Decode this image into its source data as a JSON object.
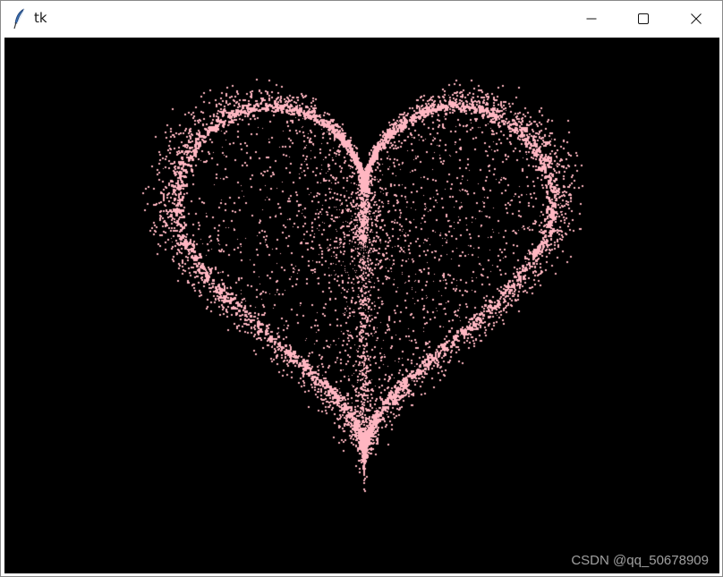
{
  "window": {
    "title": "tk",
    "icon": "tk-feather-icon",
    "controls": {
      "minimize": "minimize-icon",
      "maximize": "maximize-icon",
      "close": "close-icon"
    }
  },
  "canvas": {
    "background": "#000000",
    "particle_color": "#ffb6c1"
  },
  "watermark": {
    "text": "CSDN @qq_50678909"
  }
}
